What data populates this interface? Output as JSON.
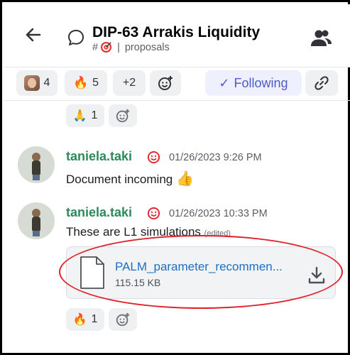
{
  "header": {
    "title": "DIP-63 Arrakis Liquidity",
    "hash": "#",
    "separator": "|",
    "channel": "proposals",
    "icons": {
      "back": "arrow-left-icon",
      "thread": "chat-bubble-icon",
      "members": "members-icon",
      "channel_emoji": "direct-hit-emoji"
    }
  },
  "reaction_bar": {
    "avatar_count": "4",
    "fire_count": "5",
    "more_label": "+2",
    "follow_label": "Following",
    "icons": {
      "add_reaction": "add-reaction-icon",
      "link": "link-icon",
      "check": "check-icon"
    }
  },
  "prior_reaction": {
    "emoji": "🙏",
    "count": "1"
  },
  "messages": [
    {
      "username": "taniela.taki",
      "timestamp": "01/26/2023 9:26 PM",
      "text": "Document incoming",
      "emoji": "👍"
    },
    {
      "username": "taniela.taki",
      "timestamp": "01/26/2023 10:33 PM",
      "text": "These are L1 simulations",
      "edited": "(edited)",
      "attachment": {
        "name": "PALM_parameter_recommen...",
        "size": "115.15 KB"
      },
      "reaction": {
        "emoji": "🔥",
        "count": "1"
      }
    }
  ],
  "colors": {
    "username": "#2c8a59",
    "link": "#1e6fc0",
    "following": "#4e5bc9",
    "annotation": "#e0212a"
  }
}
